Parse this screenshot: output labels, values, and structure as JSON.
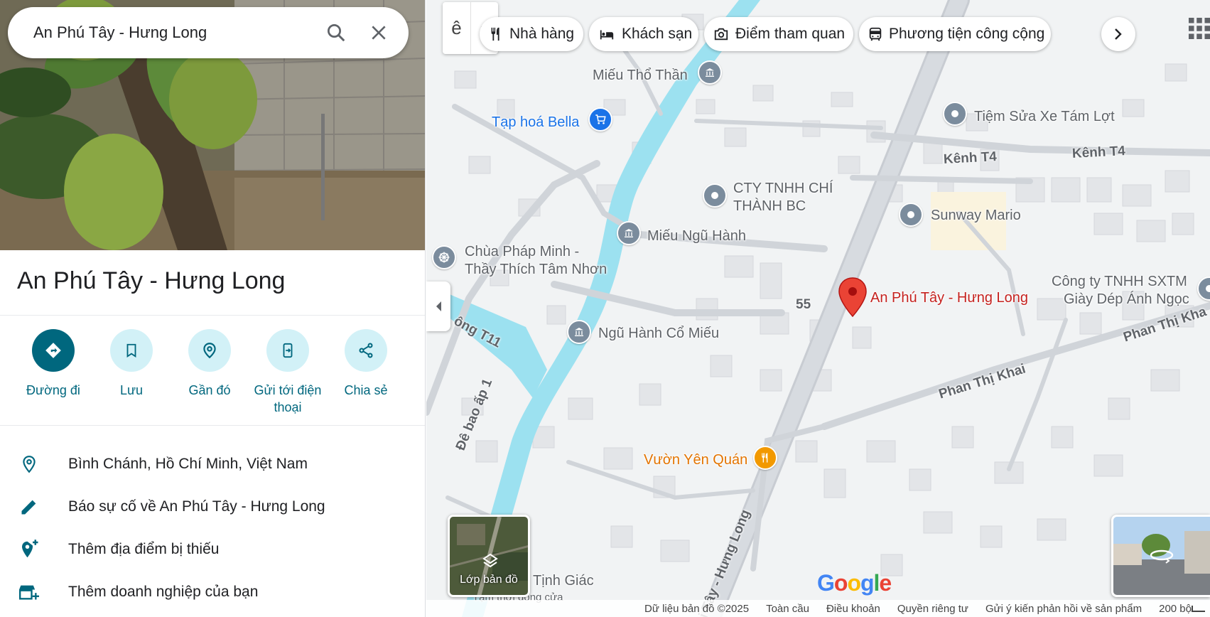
{
  "search": {
    "value": "An Phú Tây - Hưng Long"
  },
  "place": {
    "title": "An Phú Tây - Hưng Long"
  },
  "actions": [
    {
      "label": "Đường đi"
    },
    {
      "label": "Lưu"
    },
    {
      "label": "Gần đó"
    },
    {
      "label": "Gửi tới điện thoại"
    },
    {
      "label": "Chia sẻ"
    }
  ],
  "info": {
    "address": "Bình Chánh, Hồ Chí Minh, Việt Nam",
    "report": "Báo sự cố về An Phú Tây - Hưng Long",
    "add_place": "Thêm địa điểm bị thiếu",
    "add_business": "Thêm doanh nghiệp của bạn"
  },
  "map": {
    "lang_glyph": "ê",
    "chips": [
      {
        "label": "Nhà hàng",
        "icon": "restaurant-icon"
      },
      {
        "label": "Khách sạn",
        "icon": "hotel-icon"
      },
      {
        "label": "Điểm tham quan",
        "icon": "camera-icon"
      },
      {
        "label": "Phương tiện công cộng",
        "icon": "transit-icon"
      }
    ],
    "labels": {
      "mieu_tho_than": "Miếu Thổ Thần",
      "tap_hoa_bella": "Tạp hoá Bella",
      "tiem_sua_xe": "Tiệm Sửa Xe Tám Lợt",
      "kenh_t4_a": "Kênh T4",
      "kenh_t4_b": "Kênh T4",
      "cty_chi_thanh_1": "CTY TNHH CHÍ",
      "cty_chi_thanh_2": "THÀNH BC",
      "sunway_mario": "Sunway Mario",
      "mieu_ngu_hanh": "Miếu Ngũ Hành",
      "chua_phap_minh_1": "Chùa Pháp Minh -",
      "chua_phap_minh_2": "Thầy Thích Tâm Nhơn",
      "road_55": "55",
      "selected_place": "An Phú Tây - Hưng Long",
      "cong_ty_1": "Công ty TNHH SXTM",
      "cong_ty_2": "Giày Dép Ánh Ngọc",
      "ngu_hanh_co_mieu": "Ngũ Hành Cổ Miếu",
      "road_t11": "ông T11",
      "phan_thi_khai_1": "Phan Thị Kha",
      "phan_thi_khai_2": "Phan Thị Khai",
      "de_bao_ap_1": "Đê bao ấp 1",
      "vuon_yen_quan": "Vườn Yên Quán",
      "tinh_giac": "Tịnh Giác",
      "tinh_giac_sub": "Tạm thời đóng cửa",
      "road_aptay": "i Tây - Hưng Long"
    },
    "layers_label": "Lớp bản đồ",
    "footer": [
      "Dữ liệu bản đồ ©2025",
      "Toàn cầu",
      "Điều khoản",
      "Quyền riêng tư",
      "Gửi ý kiến phản hồi về sản phẩm",
      "200 bộ"
    ],
    "logo": "Google"
  },
  "colors": {
    "accent": "#00677e",
    "accent_light": "#d2f1f7",
    "pin": "#ea4335",
    "water": "#9ce1f0"
  }
}
